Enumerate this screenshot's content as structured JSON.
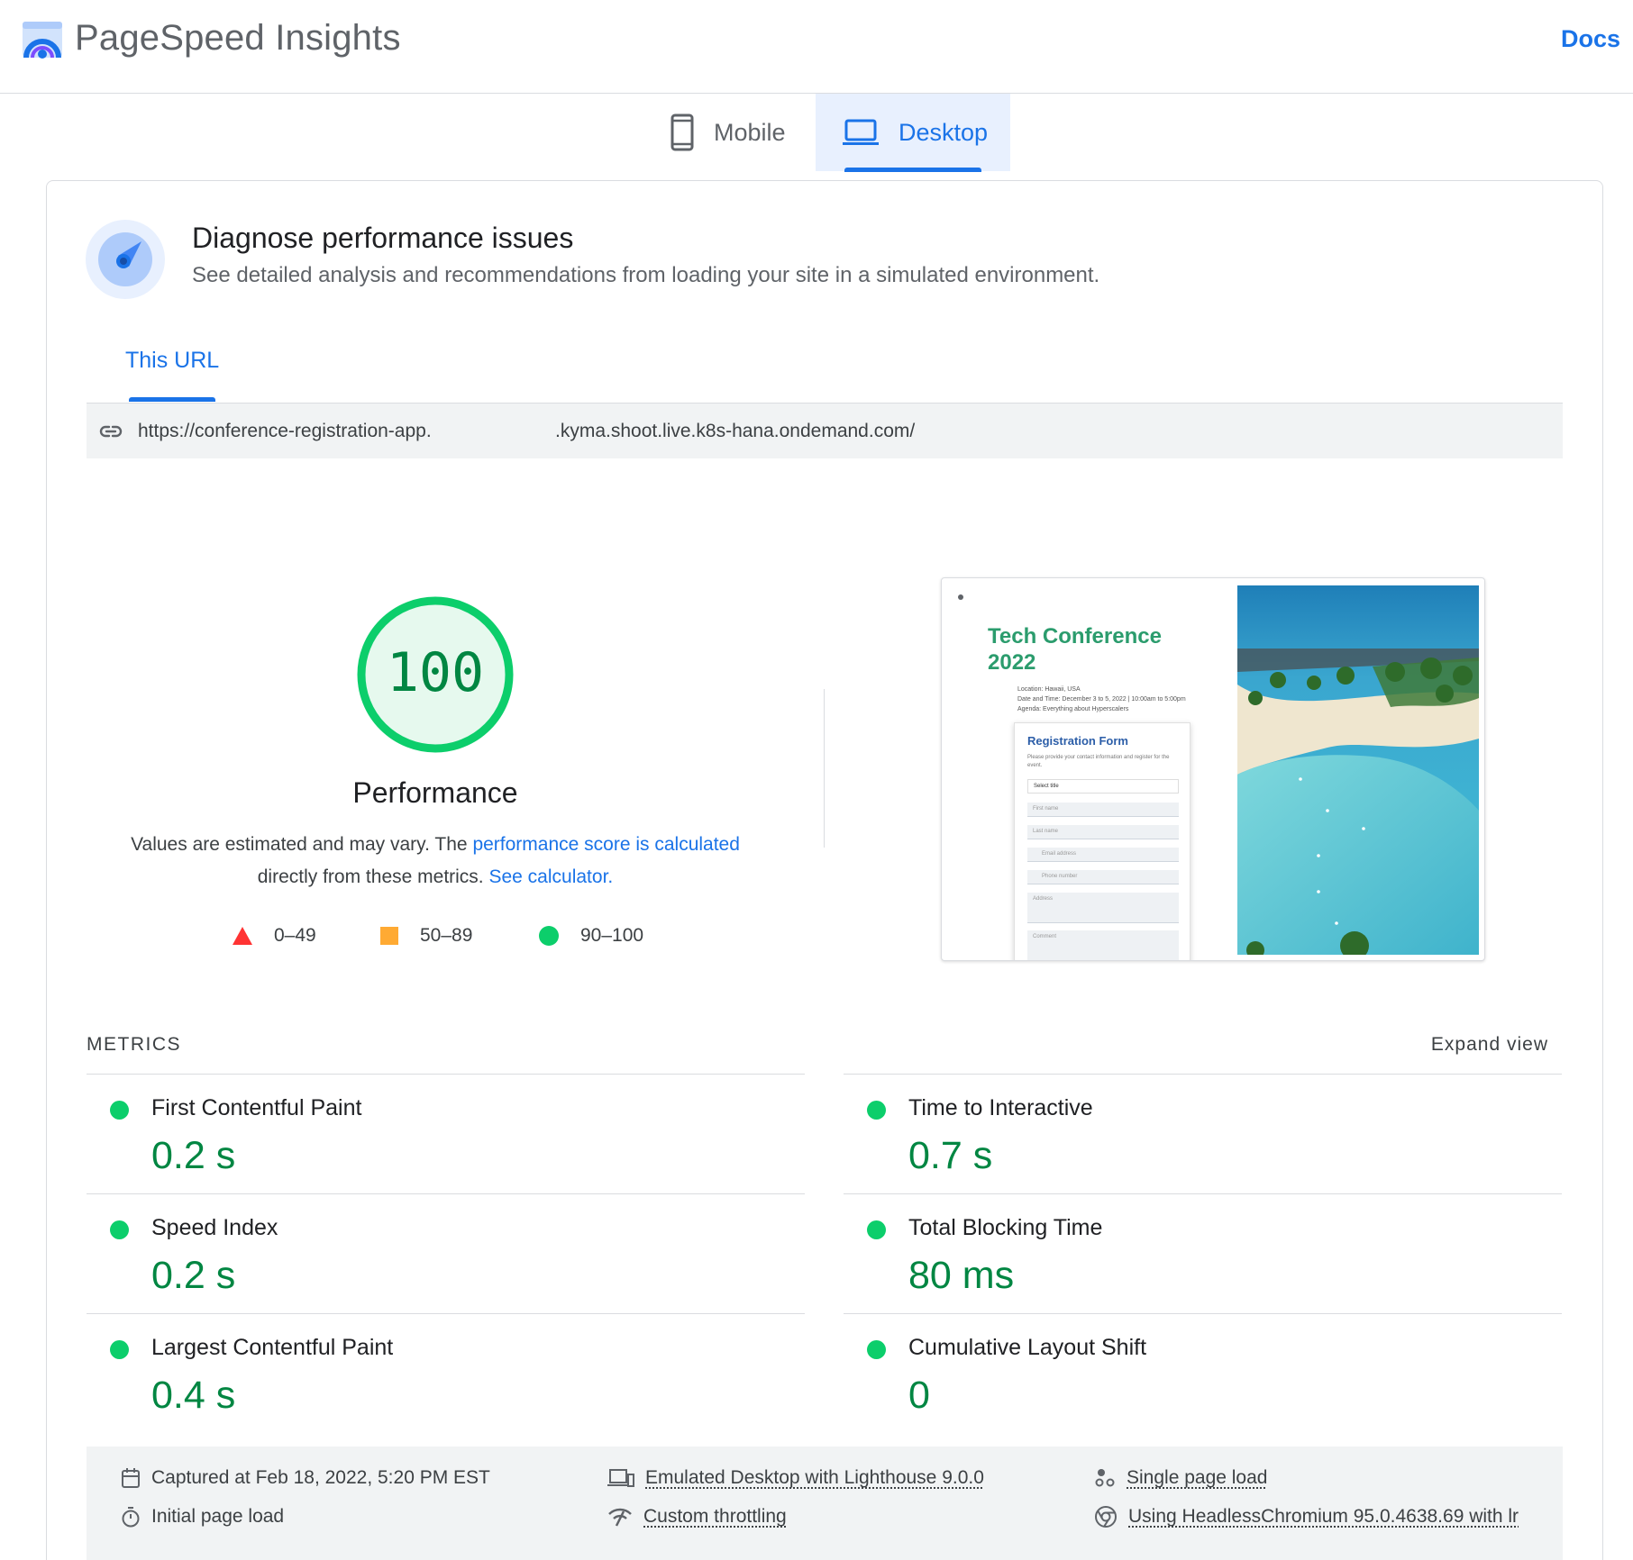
{
  "header": {
    "title": "PageSpeed Insights",
    "docs_label": "Docs"
  },
  "device_tabs": {
    "mobile_label": "Mobile",
    "desktop_label": "Desktop",
    "selected": "Desktop"
  },
  "diagnose": {
    "title": "Diagnose performance issues",
    "subtitle": "See detailed analysis and recommendations from loading your site in a simulated environment."
  },
  "url_tabs": {
    "this_url_label": "This URL"
  },
  "url_bar": {
    "url_start": "https://conference-registration-app.",
    "url_end": ".kyma.shoot.live.k8s-hana.ondemand.com/"
  },
  "performance": {
    "score": "100",
    "label": "Performance",
    "desc_prefix": "Values are estimated and may vary. The ",
    "desc_link1": "performance score is calculated",
    "desc_middle": " directly from these metrics. ",
    "desc_link2": "See calculator.",
    "legend": [
      {
        "range": "0–49",
        "color": "#ff3333",
        "shape": "triangle"
      },
      {
        "range": "50–89",
        "color": "#ffaa33",
        "shape": "square"
      },
      {
        "range": "90–100",
        "color": "#0cce6b",
        "shape": "circle"
      }
    ]
  },
  "screenshot": {
    "title_line1": "Tech Conference",
    "title_line2": "2022",
    "info_line1": "Location: Hawaii, USA",
    "info_line2": "Date and Time: December 3 to 5, 2022 | 10:00am to 5:00pm",
    "info_line3": "Agenda: Everything about Hyperscalers",
    "form_title": "Registration Form",
    "form_sub": "Please provide your contact information and register for the event.",
    "fields": [
      "Select title",
      "First name",
      "Last name",
      "Email address",
      "Phone number",
      "Address",
      "Comment"
    ]
  },
  "metrics": {
    "heading": "METRICS",
    "expand_label": "Expand view",
    "items": [
      {
        "name": "First Contentful Paint",
        "value": "0.2 s"
      },
      {
        "name": "Time to Interactive",
        "value": "0.7 s"
      },
      {
        "name": "Speed Index",
        "value": "0.2 s"
      },
      {
        "name": "Total Blocking Time",
        "value": "80 ms"
      },
      {
        "name": "Largest Contentful Paint",
        "value": "0.4 s"
      },
      {
        "name": "Cumulative Layout Shift",
        "value": "0"
      }
    ]
  },
  "footer_info": {
    "captured": "Captured at Feb 18, 2022, 5:20 PM EST",
    "initial_load": "Initial page load",
    "emulated": "Emulated Desktop with Lighthouse 9.0.0",
    "throttling": "Custom throttling",
    "single_load": "Single page load",
    "browser": "Using HeadlessChromium 95.0.4638.69 with lr"
  },
  "colors": {
    "accent": "#1a73e8",
    "pass": "#0cce6b",
    "pass_text": "#018642"
  }
}
